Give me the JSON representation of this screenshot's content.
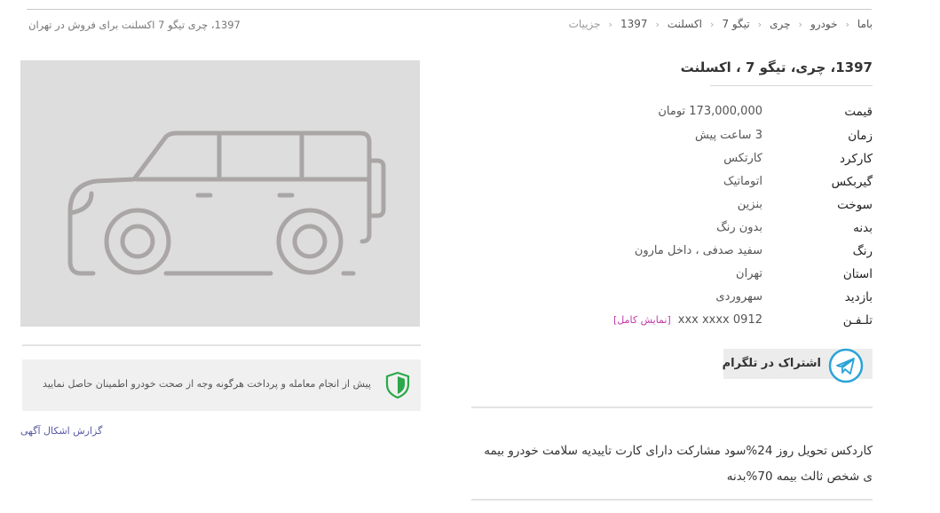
{
  "breadcrumb": {
    "items": [
      "باما",
      "خودرو",
      "چری",
      "تیگو 7",
      "اکسلنت",
      "1397",
      "جزییات"
    ],
    "separator": "‹"
  },
  "top_title": "1397، چری تیگو 7 اکسلنت برای فروش در تهران",
  "photo": {
    "icon": "car-placeholder-icon",
    "colors": {
      "background": "#dddddd",
      "outline": "#aaa6a6"
    }
  },
  "safety_notice": {
    "icon": "shield-icon",
    "text": "پیش از انجام معامله و پرداخت هرگونه وجه از صحت خودرو اطمینان حاصل نمایید",
    "icon_color": "#2ba84a"
  },
  "report_link": "گزارش اشکال آگهی",
  "car_title": "1397، چری، تیگو 7 ، اکسلنت",
  "specs": {
    "price": {
      "label": "قیمت",
      "value": "173,000,000 تومان"
    },
    "time": {
      "label": "زمان",
      "value": "3 ساعت پیش"
    },
    "mileage": {
      "label": "کارکرد",
      "value": "کارتکس"
    },
    "gearbox": {
      "label": "گیربکس",
      "value": "اتوماتیک"
    },
    "fuel": {
      "label": "سوخت",
      "value": "بنزین"
    },
    "body": {
      "label": "بدنه",
      "value": "بدون رنگ"
    },
    "color": {
      "label": "رنگ",
      "value": "سفید صدفی ، داخل مارون"
    },
    "province": {
      "label": "استان",
      "value": "تهران"
    },
    "visit": {
      "label": "بازدید",
      "value": "سهروردی"
    },
    "phone": {
      "label": "تلـفـن",
      "value": "0912 xxx xxxx",
      "show_full": "[نمایش کامل]"
    }
  },
  "telegram": {
    "label": "اشتراک در تلگرام",
    "icon": "telegram-icon",
    "icon_color": "#2aa3d8"
  },
  "description": "کاردکس تحویل روز 24%سود مشارکت دارای کارت تاییدیه سلامت خودرو بیمه ی شخص ثالث بیمه 70%بدنه"
}
